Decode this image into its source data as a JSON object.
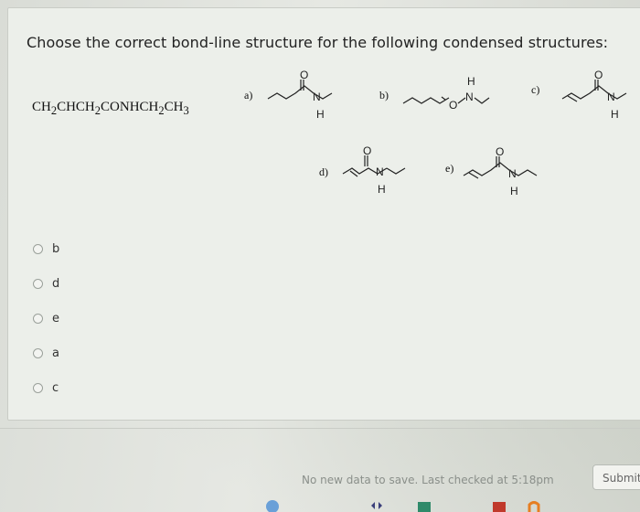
{
  "question": {
    "text": "Choose the correct bond-line structure for the following condensed structures:",
    "formula_text": "CH",
    "formula_parts": [
      "CH",
      "2",
      "CHCH",
      "2",
      "CONHCH",
      "2",
      "CH",
      "3"
    ]
  },
  "structures": [
    {
      "label": "a)",
      "atoms": [
        "O",
        "N",
        "H"
      ]
    },
    {
      "label": "b)",
      "atoms": [
        "O",
        "N",
        "H"
      ]
    },
    {
      "label": "c)",
      "atoms": [
        "O",
        "N",
        "H"
      ]
    },
    {
      "label": "d)",
      "atoms": [
        "O",
        "N",
        "H"
      ]
    },
    {
      "label": "e)",
      "atoms": [
        "O",
        "N",
        "H"
      ]
    }
  ],
  "answers": [
    "b",
    "d",
    "e",
    "a",
    "c"
  ],
  "footer": {
    "status": "No new data to save. Last checked at 5:18pm",
    "submit_label": "Submit"
  },
  "colors": {
    "accent": "#c0392b"
  }
}
